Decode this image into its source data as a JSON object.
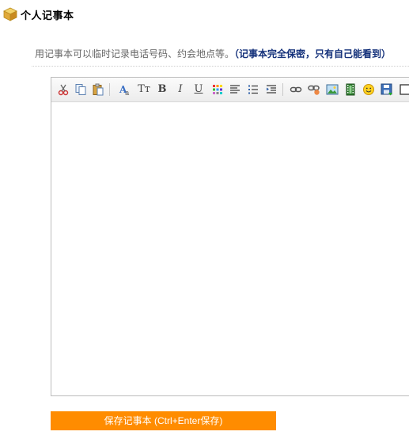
{
  "header": {
    "title": "个人记事本",
    "icon": "box-icon"
  },
  "description": {
    "text": "用记事本可以临时记录电话号码、约会地点等。",
    "note": "（记事本完全保密，只有自己能看到）"
  },
  "toolbar": {
    "items": [
      "cut-icon",
      "copy-icon",
      "paste-icon",
      "font-icon",
      "font-size-icon",
      "bold-icon",
      "italic-icon",
      "underline-icon",
      "color-icon",
      "align-icon",
      "list-icon",
      "indent-icon",
      "link-icon",
      "unlink-icon",
      "image-icon",
      "video-icon",
      "emoticon-icon",
      "save-icon",
      "checkbox-icon"
    ],
    "bold_label": "B",
    "italic_label": "I",
    "underline_label": "U",
    "font_size_label": "Tт"
  },
  "editor": {
    "content": ""
  },
  "save_button": {
    "label": "保存记事本 (Ctrl+Enter保存)"
  },
  "colors": {
    "accent": "#ff8c00",
    "note": "#13307a",
    "border": "#bcbcbc"
  }
}
